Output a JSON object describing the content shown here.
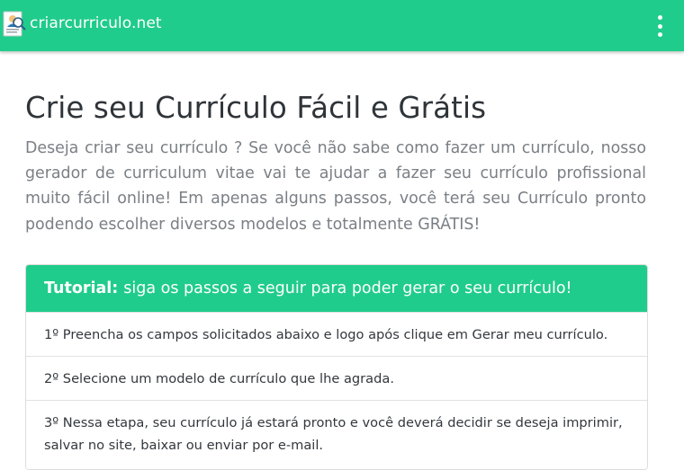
{
  "navbar": {
    "brand": "criarcurriculo.net",
    "logo_icon": "resume-document-icon",
    "menu_icon": "vertical-dots-menu-icon",
    "bg_color": "#20cc8b"
  },
  "main": {
    "title": "Crie seu Currículo Fácil e Grátis",
    "lead": "Deseja criar seu currículo ? Se você não sabe como fazer um currículo, nosso gerador de curriculum vitae vai te ajudar a fazer seu currículo profissional muito fácil online! Em apenas alguns passos, você terá seu Currículo pronto podendo escolher diversos modelos e totalmente GRÁTIS!"
  },
  "tutorial": {
    "label": "Tutorial:",
    "heading": "siga os passos a seguir para poder gerar o seu currículo!",
    "steps": [
      "1º Preencha os campos solicitados abaixo e logo após clique em Gerar meu currículo.",
      "2º Selecione um modelo de currículo que lhe agrada.",
      "3º Nessa etapa, seu currículo já estará pronto e você deverá decidir se deseja imprimir, salvar no site, baixar ou enviar por e-mail."
    ]
  }
}
